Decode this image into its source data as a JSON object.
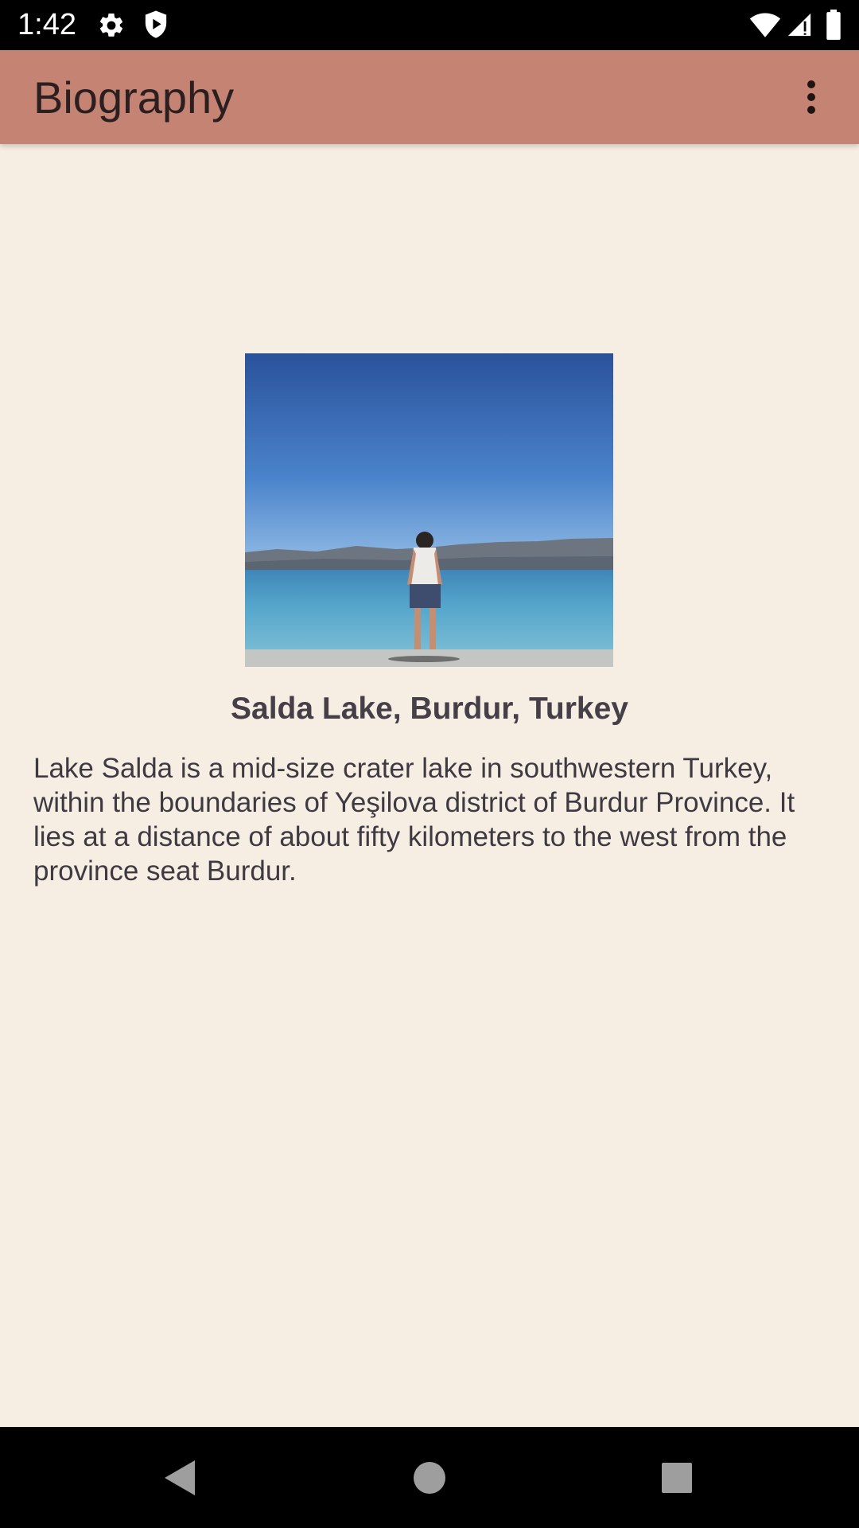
{
  "status_bar": {
    "time": "1:42",
    "icons": [
      "gear-icon",
      "shield-icon",
      "wifi-icon",
      "cell-signal-icon",
      "battery-icon"
    ]
  },
  "app_bar": {
    "title": "Biography",
    "menu_icon": "more-vert-icon"
  },
  "main": {
    "photo_description_icon": "lake-photo",
    "caption": "Salda Lake, Burdur, Turkey",
    "description": "Lake Salda is a mid-size crater lake in southwestern Turkey, within the boundaries of Yeşilova district of Burdur Province. It lies at a distance of about fifty kilometers to the west from the province seat Burdur."
  },
  "nav_bar": {
    "buttons": [
      "back-icon",
      "home-icon",
      "recents-icon"
    ]
  },
  "colors": {
    "app_bar": "#C48373",
    "background": "#F6EEE3",
    "text": "#3F3A42"
  }
}
